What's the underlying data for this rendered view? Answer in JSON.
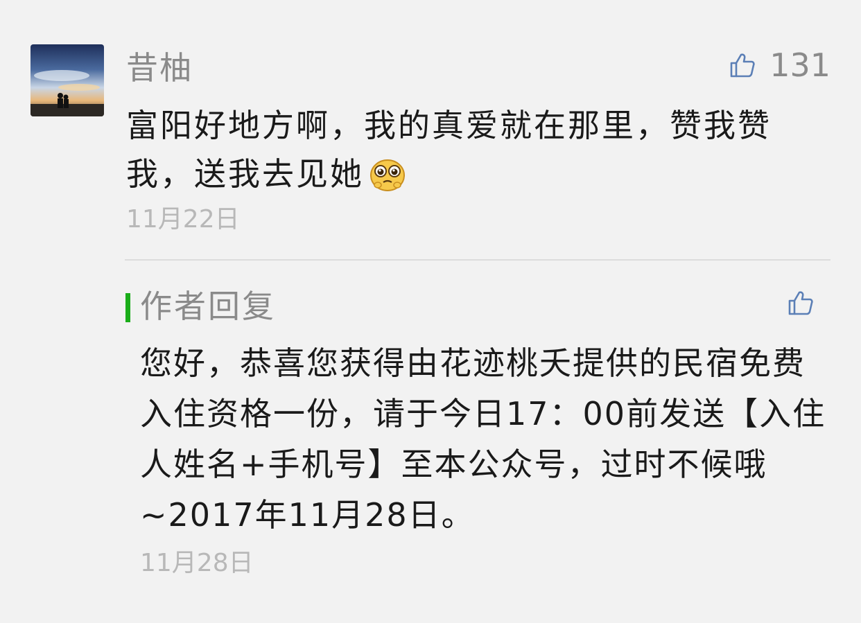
{
  "comment": {
    "author": "昔柚",
    "likes": "131",
    "text": "富阳好地方啊，我的真爱就在那里，赞我赞我，送我去见她",
    "emoji": "pleading-face-emoji",
    "date": "11月22日",
    "like_icon": "thumbs-up-icon",
    "avatar": "sunset-silhouette-avatar"
  },
  "reply": {
    "label": "作者回复",
    "text": "您好，恭喜您获得由花迹桃夭提供的民宿免费入住资格一份，请于今日17：00前发送【入住人姓名+手机号】至本公众号，过时不候哦~2017年11月28日。",
    "date": "11月28日",
    "like_icon": "thumbs-up-icon",
    "accent_color": "#1aad19"
  },
  "colors": {
    "background": "#f2f2f2",
    "icon_blue": "#5b7fb6",
    "meta_gray": "#8a8a8a",
    "date_gray": "#b8b8b8",
    "text": "#1a1a1a"
  }
}
